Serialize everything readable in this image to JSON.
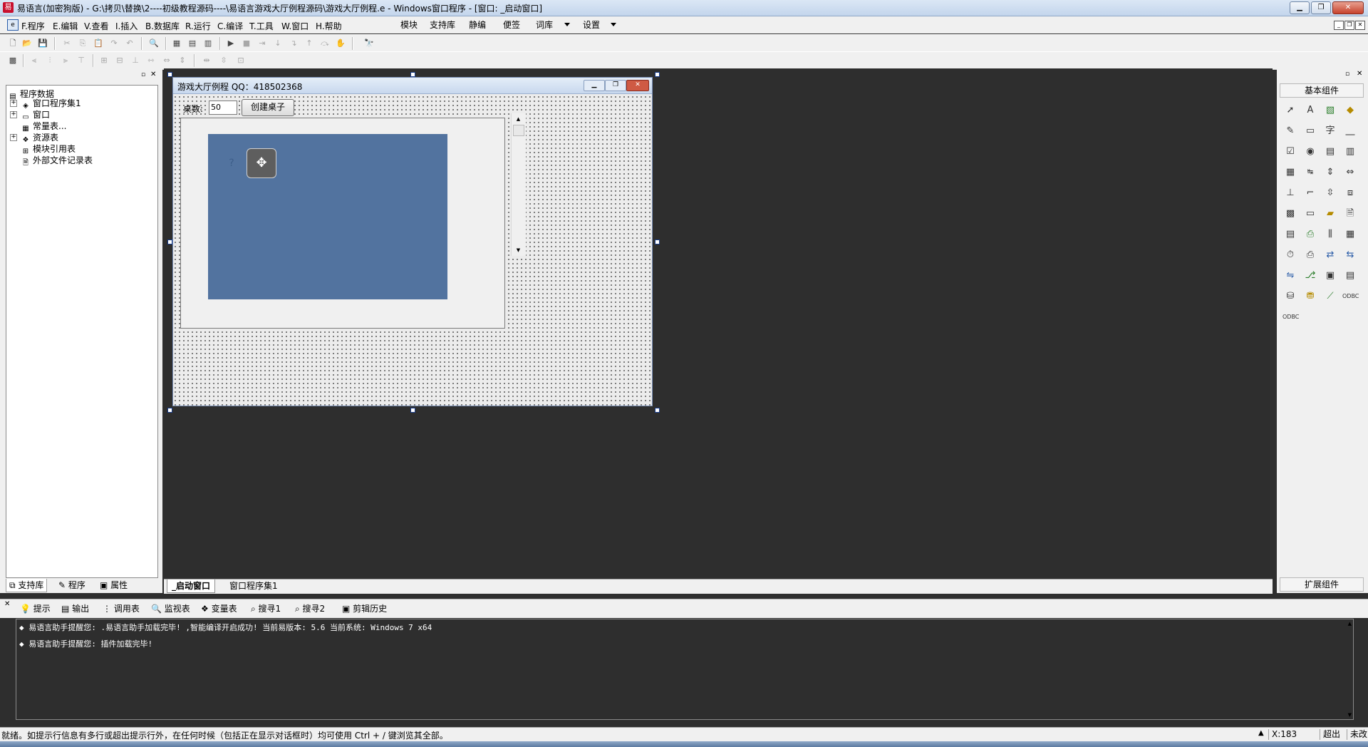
{
  "window": {
    "title": "易语言(加密狗版) - G:\\拷贝\\替换\\2----初级教程源码----\\易语言游戏大厅例程源码\\游戏大厅例程.e - Windows窗口程序 - [窗口: _启动窗口]"
  },
  "menubar": {
    "items": [
      "F.程序",
      "E.编辑",
      "V.查看",
      "I.插入",
      "B.数据库",
      "R.运行",
      "C.编译",
      "T.工具",
      "W.窗口",
      "H.帮助"
    ],
    "extra": [
      "模块",
      "支持库",
      "静编",
      "便签",
      "词库",
      "设置"
    ]
  },
  "left_panel": {
    "tree": [
      {
        "label": "程序数据",
        "icon": "program-data-icon"
      },
      {
        "label": "窗口程序集1",
        "icon": "assembly-icon"
      },
      {
        "label": "窗口",
        "icon": "window-icon"
      },
      {
        "label": "常量表...",
        "icon": "constant-icon"
      },
      {
        "label": "资源表",
        "icon": "resource-icon"
      },
      {
        "label": "模块引用表",
        "icon": "module-icon"
      },
      {
        "label": "外部文件记录表",
        "icon": "file-icon"
      }
    ],
    "tabs": [
      "支持库",
      "程序",
      "属性"
    ]
  },
  "form": {
    "title": "游戏大厅例程   QQ：418502368",
    "label_zhuoshu": "桌数:",
    "input_zhuoshu": "50",
    "create_button": "创建桌子",
    "placeholder_icon": "qq-penguin-icon",
    "move_icon": "move-cross-icon"
  },
  "right_panel": {
    "header": "基本组件",
    "footer": "扩展组件"
  },
  "editor_tabs": [
    "_启动窗口",
    "窗口程序集1"
  ],
  "output_tabs": [
    "提示",
    "输出",
    "调用表",
    "监视表",
    "变量表",
    "搜寻1",
    "搜寻2",
    "剪辑历史"
  ],
  "output_lines": [
    "◆ 易语言助手提醒您: .易语言助手加载完毕! ,智能编译开启成功! 当前易版本: 5.6 当前系统: Windows 7 x64",
    "◆ 易语言助手提醒您: 插件加载完毕!"
  ],
  "statusbar": {
    "message": "就绪。如提示行信息有多行或超出提示行外，在任何时候（包括正在显示对话框时）均可使用 Ctrl + / 键浏览其全部。",
    "coord": "X:183",
    "mode": "超出",
    "state": "未改"
  }
}
